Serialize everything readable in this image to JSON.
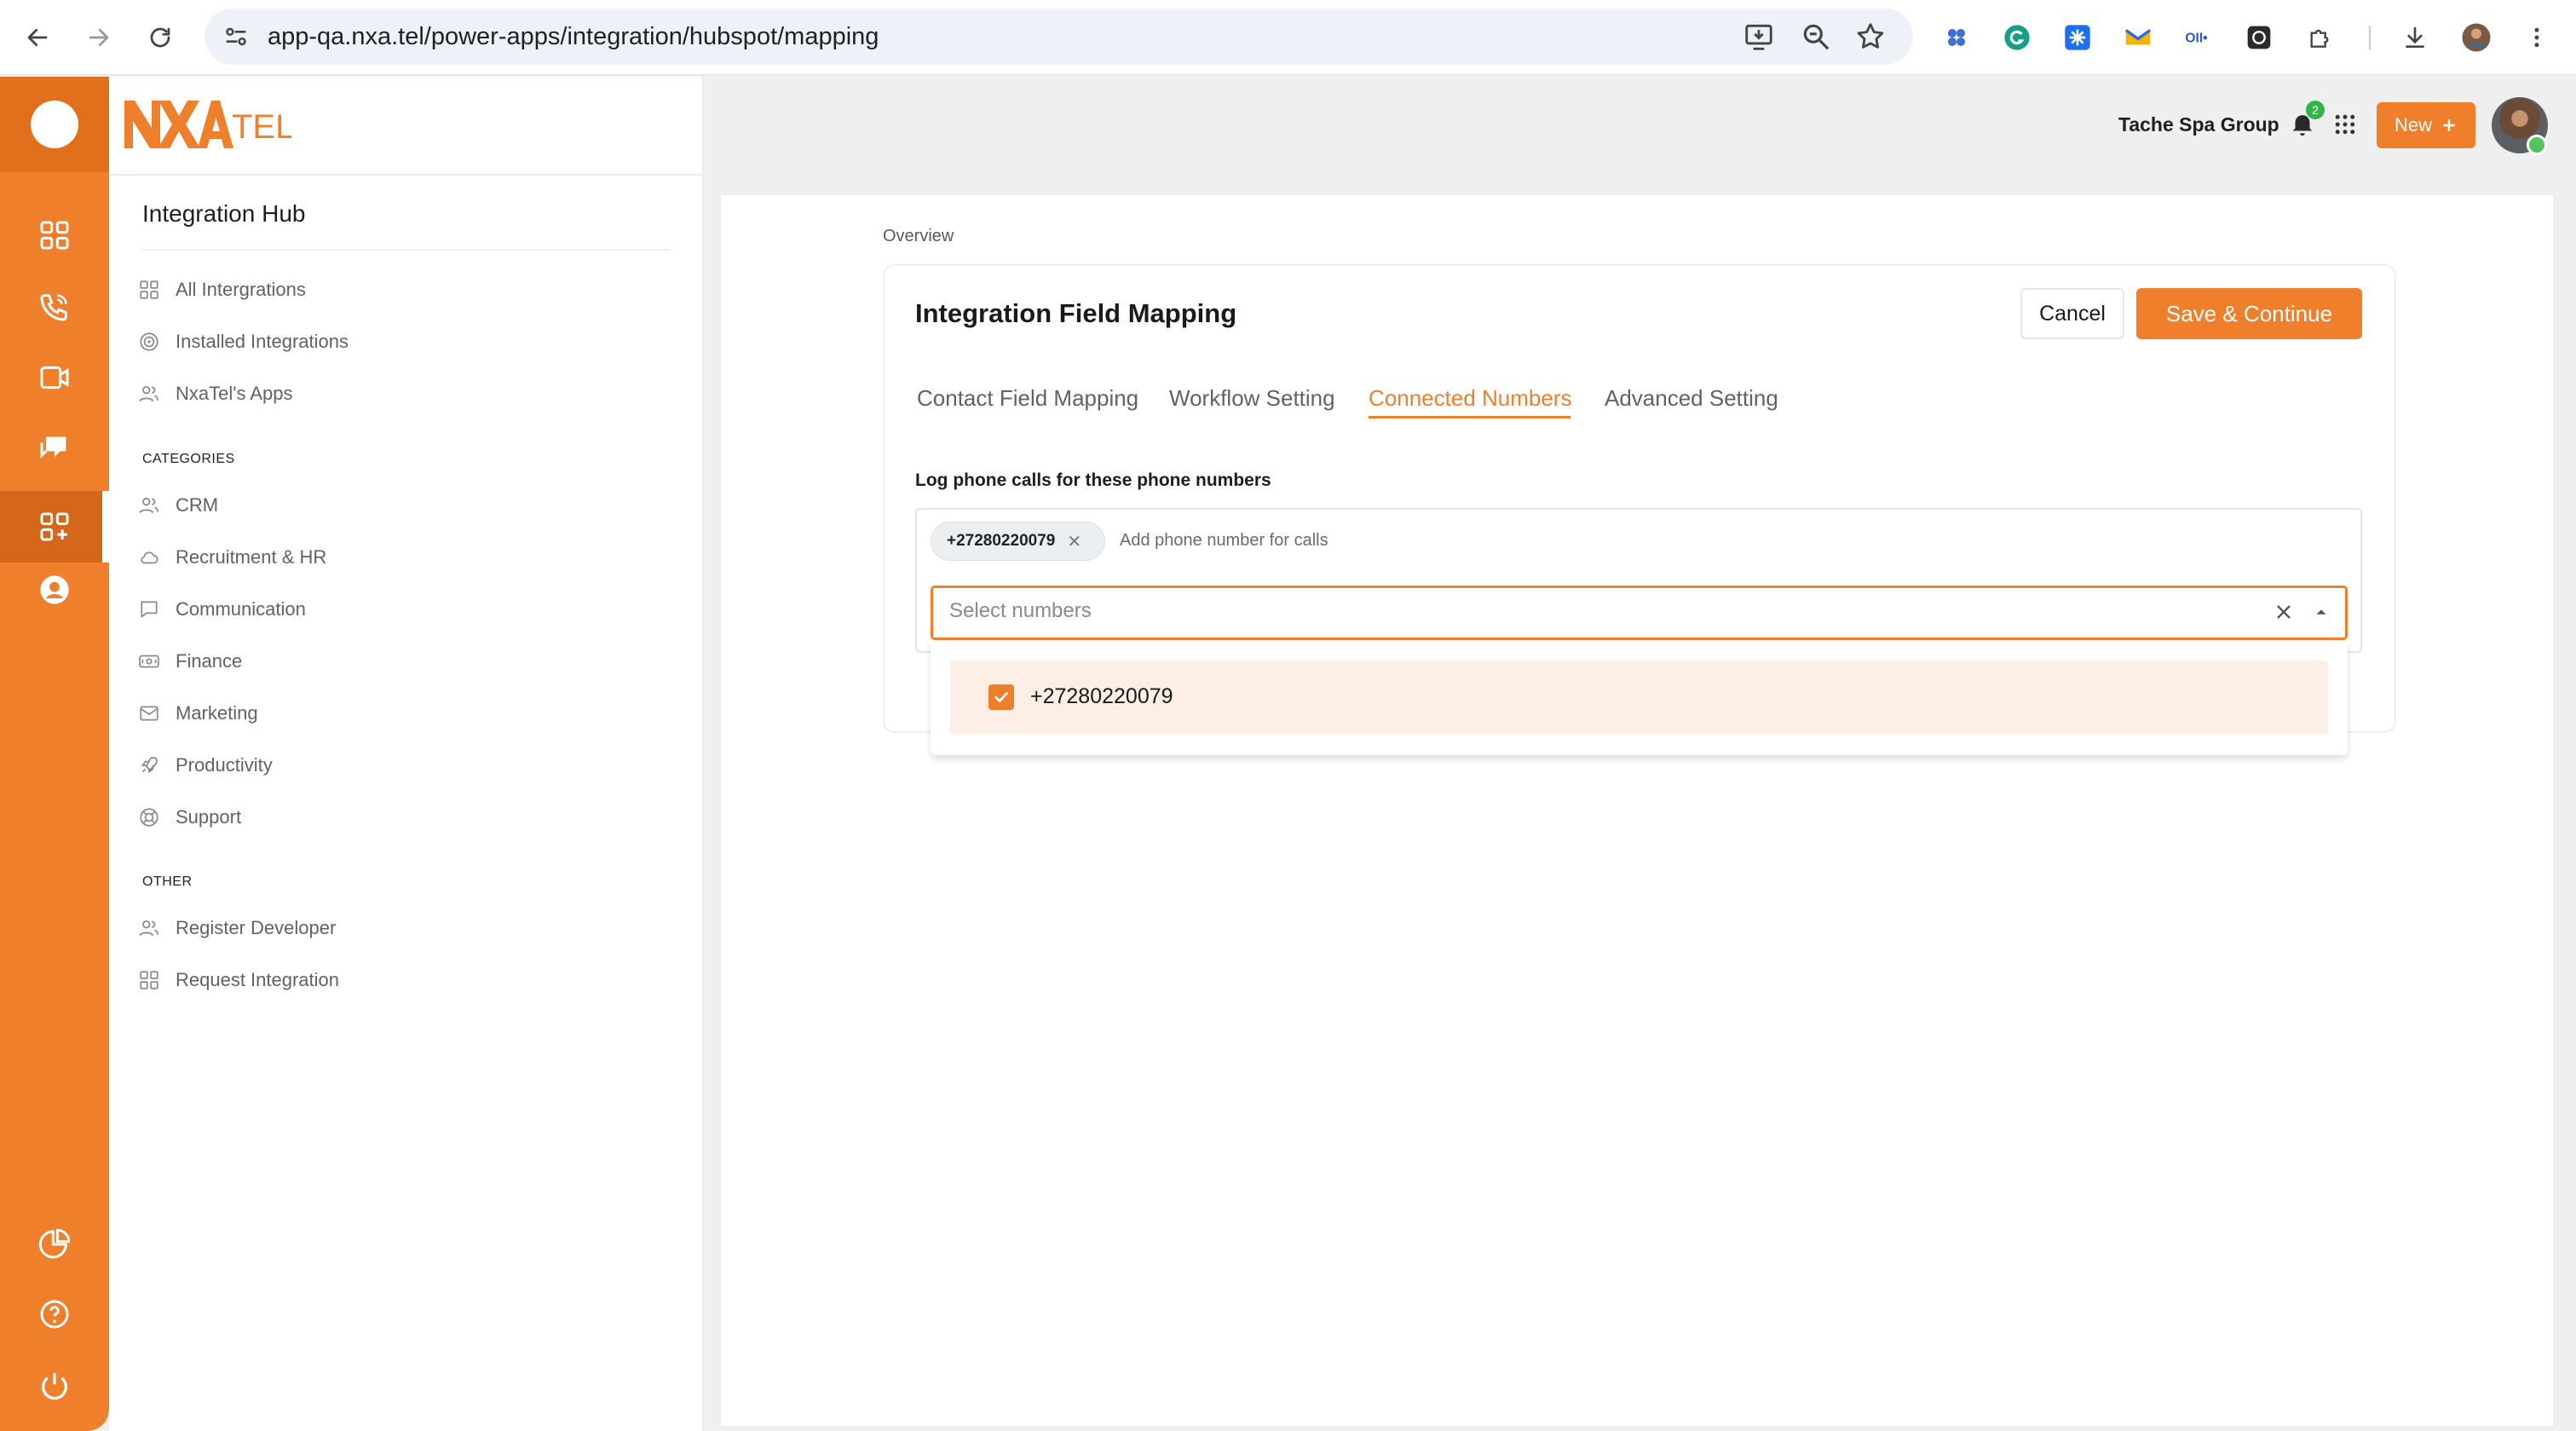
{
  "browser": {
    "url": "app-qa.nxa.tel/power-apps/integration/hubspot/mapping"
  },
  "brand": {
    "logo_text": "NXATEL",
    "accent": "#f07f2b"
  },
  "topbar": {
    "company": "Tache Spa Group",
    "notification_count": "2",
    "new_button": "New"
  },
  "sidebar": {
    "title": "Integration Hub",
    "main_items": [
      {
        "label": "All Intergrations",
        "icon": "grid-icon"
      },
      {
        "label": "Installed Integrations",
        "icon": "target-icon"
      },
      {
        "label": "NxaTel's Apps",
        "icon": "users-icon"
      }
    ],
    "categories_heading": "CATEGORIES",
    "categories": [
      {
        "label": "CRM",
        "icon": "users-icon"
      },
      {
        "label": "Recruitment & HR",
        "icon": "cloud-icon"
      },
      {
        "label": "Communication",
        "icon": "chat-icon"
      },
      {
        "label": "Finance",
        "icon": "money-icon"
      },
      {
        "label": "Marketing",
        "icon": "mail-icon"
      },
      {
        "label": "Productivity",
        "icon": "rocket-icon"
      },
      {
        "label": "Support",
        "icon": "lifebuoy-icon"
      }
    ],
    "other_heading": "OTHER",
    "other": [
      {
        "label": "Register Developer",
        "icon": "users-icon"
      },
      {
        "label": "Request Integration",
        "icon": "grid-icon"
      }
    ]
  },
  "main": {
    "breadcrumb": "Overview",
    "title": "Integration Field Mapping",
    "cancel_label": "Cancel",
    "save_label": "Save & Continue",
    "tabs": [
      {
        "label": "Contact Field Mapping",
        "active": false
      },
      {
        "label": "Workflow Setting",
        "active": false
      },
      {
        "label": "Connected Numbers",
        "active": true
      },
      {
        "label": "Advanced Setting",
        "active": false
      }
    ],
    "log_label": "Log phone calls for these phone numbers",
    "chip_value": "+27280220079",
    "add_phone_placeholder": "Add phone number for calls",
    "select_placeholder": "Select numbers",
    "options": [
      {
        "label": "+27280220079",
        "checked": true
      }
    ]
  }
}
